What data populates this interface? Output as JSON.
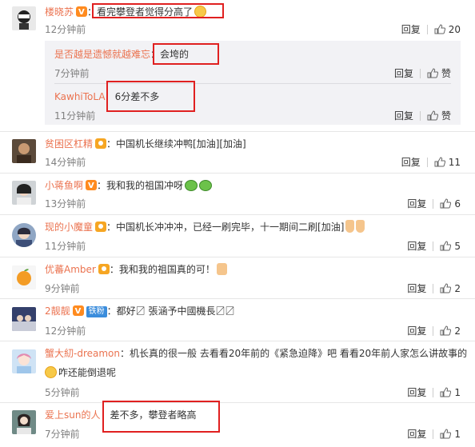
{
  "comments": [
    {
      "name": "楼晓苏",
      "text": "看完攀登者觉得分高了",
      "time": "12分钟前",
      "reply": "回复",
      "likes": "20"
    },
    {
      "name": "贫困区杠精",
      "text": "：中国机长继续冲鸭[加油][加油]",
      "time": "14分钟前",
      "reply": "回复",
      "likes": "11"
    },
    {
      "name": "小蒋鱼啊",
      "text": "：我和我的祖国冲呀",
      "time": "13分钟前",
      "reply": "回复",
      "likes": "6"
    },
    {
      "name": "现的小魔童",
      "text": "：中国机长冲冲冲，已经一刷完毕，十一期间二刷[加油]",
      "time": "11分钟前",
      "reply": "回复",
      "likes": "5"
    },
    {
      "name": "优蕃Amber",
      "text": "：我和我的祖国真的可！",
      "time": "9分钟前",
      "reply": "回复",
      "likes": "2"
    },
    {
      "name": "2靓靓",
      "tag": "铁粉",
      "text": "：都好〼 張涵予中國機長〼〼",
      "time": "12分钟前",
      "reply": "回复",
      "likes": "2"
    },
    {
      "name": "蟹大糿-dreamon",
      "text": "：机长真的很一般 去看看20年前的《紧急迫降》吧 看看20年前人家怎么讲故事的",
      "text2": "咋还能倒退呢",
      "time": "5分钟前",
      "reply": "回复",
      "likes": "1"
    },
    {
      "name": "爱上sun的人",
      "text": "差不多，攀登者略高",
      "time": "7分钟前",
      "reply": "回复",
      "likes": "1"
    }
  ],
  "replies": [
    {
      "name": "是否越是遗憾就越难忘",
      "text": "：会垮的",
      "time": "7分钟前",
      "reply": "回复",
      "like_label": "赞"
    },
    {
      "name": "KawhiToLA",
      "text": "6分差不多",
      "time": "11分钟前",
      "reply": "回复",
      "like_label": "赞"
    }
  ]
}
